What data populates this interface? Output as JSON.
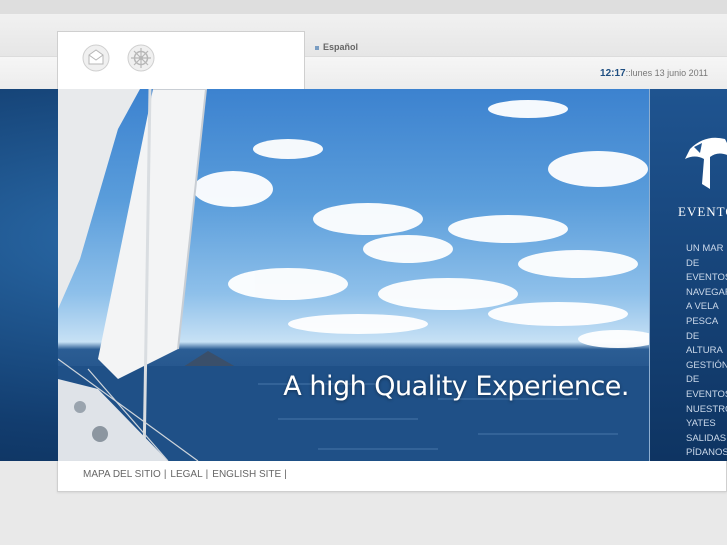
{
  "header": {
    "language_label": "Español",
    "clock_time": "12:17",
    "clock_date": "::lunes 13 junio 2011",
    "mail_icon": "envelope-icon",
    "helm_icon": "ship-wheel-icon"
  },
  "hero": {
    "tagline": "A high Quality Experience.",
    "brand": "EVENTOS"
  },
  "menu": {
    "items": [
      "UN MAR",
      "DE",
      "EVENTOS",
      "NAVEGAR",
      "A VELA",
      "PESCA",
      "DE",
      "ALTURA",
      "GESTIÓN",
      "DE",
      "EVENTOS",
      "NUESTROS",
      "YATES",
      "SALIDAS",
      "PÍDANOS"
    ]
  },
  "footer": {
    "links": [
      "MAPA DEL SITIO",
      "LEGAL",
      "ENGLISH SITE"
    ],
    "separator": "|"
  },
  "colors": {
    "background": "#e9e9e9",
    "accent": "#1f4f82",
    "panel_blue": "#0e3462"
  }
}
